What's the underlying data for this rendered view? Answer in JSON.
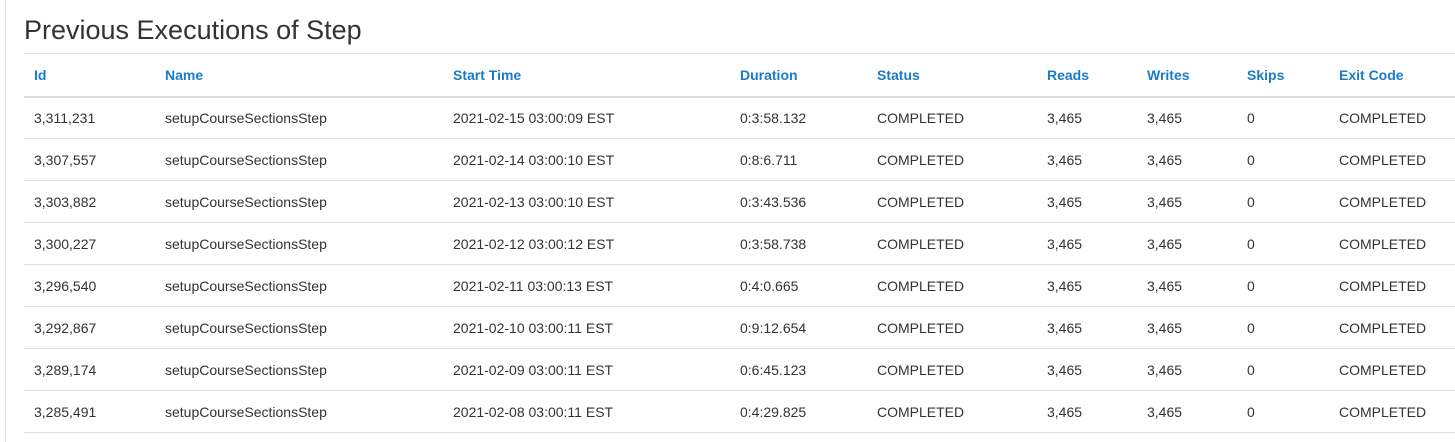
{
  "page_title": "Previous Executions of Step",
  "columns": [
    "Id",
    "Name",
    "Start Time",
    "Duration",
    "Status",
    "Reads",
    "Writes",
    "Skips",
    "Exit Code"
  ],
  "rows": [
    [
      "3,311,231",
      "setupCourseSectionsStep",
      "2021-02-15 03:00:09 EST",
      "0:3:58.132",
      "COMPLETED",
      "3,465",
      "3,465",
      "0",
      "COMPLETED"
    ],
    [
      "3,307,557",
      "setupCourseSectionsStep",
      "2021-02-14 03:00:10 EST",
      "0:8:6.711",
      "COMPLETED",
      "3,465",
      "3,465",
      "0",
      "COMPLETED"
    ],
    [
      "3,303,882",
      "setupCourseSectionsStep",
      "2021-02-13 03:00:10 EST",
      "0:3:43.536",
      "COMPLETED",
      "3,465",
      "3,465",
      "0",
      "COMPLETED"
    ],
    [
      "3,300,227",
      "setupCourseSectionsStep",
      "2021-02-12 03:00:12 EST",
      "0:3:58.738",
      "COMPLETED",
      "3,465",
      "3,465",
      "0",
      "COMPLETED"
    ],
    [
      "3,296,540",
      "setupCourseSectionsStep",
      "2021-02-11 03:00:13 EST",
      "0:4:0.665",
      "COMPLETED",
      "3,465",
      "3,465",
      "0",
      "COMPLETED"
    ],
    [
      "3,292,867",
      "setupCourseSectionsStep",
      "2021-02-10 03:00:11 EST",
      "0:9:12.654",
      "COMPLETED",
      "3,465",
      "3,465",
      "0",
      "COMPLETED"
    ],
    [
      "3,289,174",
      "setupCourseSectionsStep",
      "2021-02-09 03:00:11 EST",
      "0:6:45.123",
      "COMPLETED",
      "3,465",
      "3,465",
      "0",
      "COMPLETED"
    ],
    [
      "3,285,491",
      "setupCourseSectionsStep",
      "2021-02-08 03:00:11 EST",
      "0:4:29.825",
      "COMPLETED",
      "3,465",
      "3,465",
      "0",
      "COMPLETED"
    ]
  ],
  "colors": {
    "header_link": "#1a7bc8",
    "text": "#333333",
    "border": "#dddddd"
  }
}
